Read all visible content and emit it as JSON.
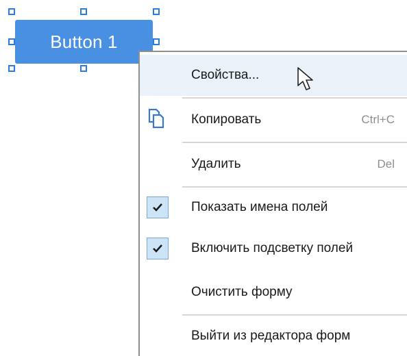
{
  "form_button": {
    "label": "Button 1"
  },
  "context_menu": {
    "items": [
      {
        "label": "Свойства...",
        "shortcut": ""
      },
      {
        "label": "Копировать",
        "shortcut": "Ctrl+C",
        "icon": "copy-icon"
      },
      {
        "label": "Удалить",
        "shortcut": "Del"
      },
      {
        "label": "Показать имена полей",
        "checked": true
      },
      {
        "label": "Включить подсветку полей",
        "checked": true
      },
      {
        "label": "Очистить форму"
      },
      {
        "label": "Выйти из редактора форм"
      }
    ]
  },
  "colors": {
    "button_bg": "#4a90e2",
    "handle_border": "#2a7de0",
    "hover_bg": "#eaf1f8",
    "check_bg": "#cde3f6"
  }
}
